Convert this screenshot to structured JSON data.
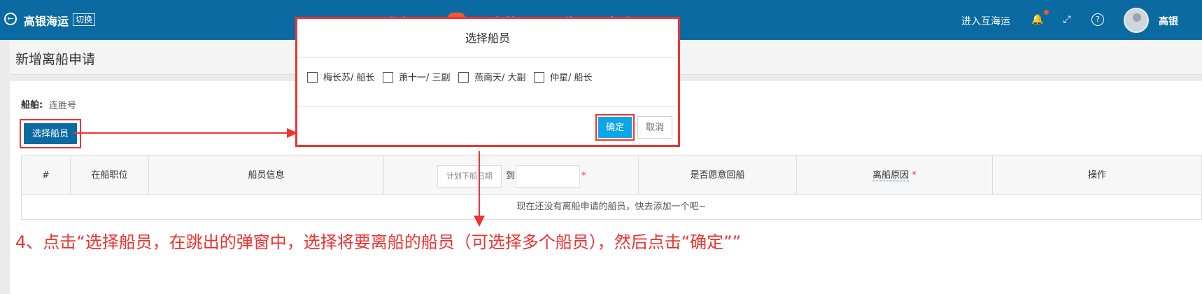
{
  "topbar": {
    "back_icon": "←",
    "brand": "高银海运",
    "switch_label": "切换",
    "nav": [
      "工作台",
      "船舶ISC",
      "代理",
      "帮助"
    ],
    "nav_badge": "···",
    "enter_link": "进入互海运",
    "bell_icon": "🔔",
    "fullscreen_icon": "⤢",
    "help_icon": "?",
    "username": "高银"
  },
  "page": {
    "title": "新增离船申请",
    "ship_label": "船舶:",
    "ship_value": "连胜号",
    "select_crew_button": "选择船员"
  },
  "table": {
    "headers": {
      "index": "#",
      "position": "在船职位",
      "crew_info": "船员信息",
      "plan_date_placeholder": "计划下船日期",
      "to": "到",
      "return_willing": "是否愿意回船",
      "reason": "离船原因",
      "actions": "操作"
    },
    "required_mark": "*",
    "empty_text": "现在还没有离船申请的船员，快去添加一个吧~"
  },
  "modal": {
    "title": "选择船员",
    "crew_options": [
      {
        "label": "梅长苏/ 船长",
        "checked": false
      },
      {
        "label": "萧十一/ 三副",
        "checked": false
      },
      {
        "label": "燕南天/ 大副",
        "checked": false
      },
      {
        "label": "仲星/ 船长",
        "checked": false
      }
    ],
    "confirm": "确定",
    "cancel": "取消"
  },
  "instruction": "4、点击“选择船员，在跳出的弹窗中，选择将要离船的船员（可选择多个船员），然后点击“确定””",
  "colors": {
    "topbar": "#0a6aa1",
    "primary_button": "#0a6aa1",
    "confirm_button": "#0aa6e8",
    "annotation": "#e33333"
  }
}
